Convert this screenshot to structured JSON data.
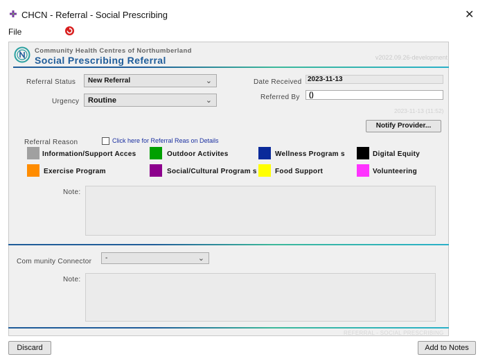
{
  "window": {
    "title": "CHCN - Referral - Social Prescribing",
    "close_glyph": "✕"
  },
  "menu": {
    "file": "File"
  },
  "header": {
    "org_name": "Community Health Centres of Northumberland",
    "form_title": "Social Prescribing Referral",
    "version": "v2022.09.26-development"
  },
  "form": {
    "referral_status_label": "Referral Status",
    "referral_status_value": "New Referral",
    "urgency_label": "Urgency",
    "urgency_value": "Routine",
    "date_received_label": "Date Received",
    "date_received_value": "2023-11-13",
    "referred_by_label": "Referred By",
    "referred_by_value": "()",
    "timestamp": "2023-11-13 (11:52)",
    "notify_button": "Notify Provider..."
  },
  "referral_reason": {
    "label": "Referral Reason",
    "details_checkbox_label": "Click here for Referral Reas on Details",
    "categories": [
      {
        "label": "Information/Support Acces",
        "color": "#a0a0a0"
      },
      {
        "label": "Outdoor Activites",
        "color": "#00a000"
      },
      {
        "label": "Wellness Program s",
        "color": "#0a2a9a"
      },
      {
        "label": "Digital Equity",
        "color": "#000000"
      },
      {
        "label": "Exercise Program",
        "color": "#ff8c00"
      },
      {
        "label": "Social/Cultural Program s",
        "color": "#8c008c"
      },
      {
        "label": "Food Support",
        "color": "#ffff00"
      },
      {
        "label": "Volunteering",
        "color": "#ff33ff"
      }
    ],
    "note_label": "Note:"
  },
  "connector": {
    "label": "Com munity Connector",
    "value": "-",
    "note_label": "Note:"
  },
  "footer": {
    "tag": "REFERRAL - SOCIAL PRESCRIBING"
  },
  "buttons": {
    "discard": "Discard",
    "add_to_notes": "Add to Notes"
  }
}
